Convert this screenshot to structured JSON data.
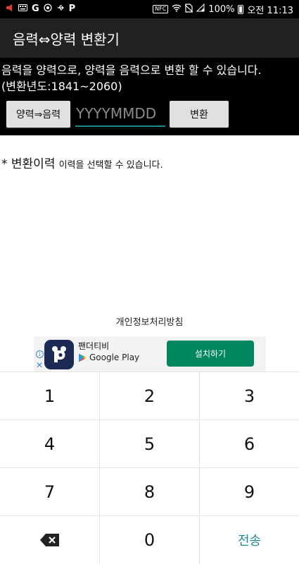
{
  "status_bar": {
    "battery": "100%",
    "time": "오전 11:13",
    "nfc": "NFC",
    "google": "G",
    "app_letter": "P"
  },
  "app_bar": {
    "title": "음력⇔양력 변환기"
  },
  "header": {
    "description_line1": "음력을 양력으로, 양력을 음력으로 변환 할 수 있습니다.",
    "description_line2": "(변환년도:1841~2060)",
    "mode_button_label": "양력⇒음력",
    "date_input": {
      "value": "",
      "placeholder": "YYYYMMDD"
    },
    "convert_button_label": "변환"
  },
  "history": {
    "title": "* 변환이력",
    "hint": "이력을 선택할 수 있습니다."
  },
  "privacy_link": "개인정보처리방침",
  "ad": {
    "app_name": "팬더티비",
    "store_label": "Google Play",
    "install_button_label": "설치하기",
    "info_glyph": "i",
    "close_glyph": "✕",
    "logo_letter": "P"
  },
  "keypad": {
    "keys": [
      "1",
      "2",
      "3",
      "4",
      "5",
      "6",
      "7",
      "8",
      "9",
      "",
      "0",
      "전송"
    ]
  },
  "colors": {
    "accent": "#1e8a8f",
    "install_button": "#01875f",
    "app_bar": "#212121",
    "panel": "#000000"
  }
}
